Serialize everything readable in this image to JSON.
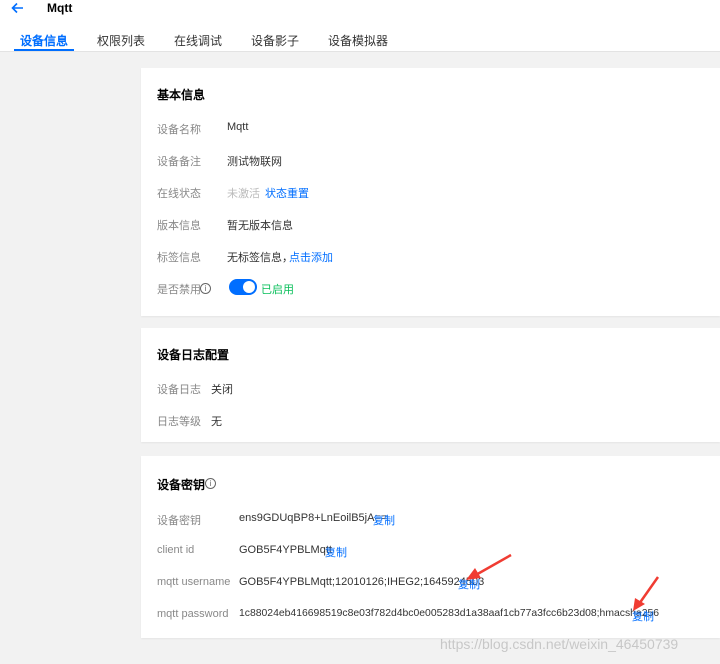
{
  "header": {
    "title": "Mqtt",
    "tabs": [
      "设备信息",
      "权限列表",
      "在线调试",
      "设备影子",
      "设备模拟器"
    ]
  },
  "basic": {
    "title": "基本信息",
    "name_label": "设备名称",
    "name_value": "Mqtt",
    "remark_label": "设备备注",
    "remark_value": "测试物联网",
    "online_label": "在线状态",
    "online_value": "未激活",
    "online_link": "状态重置",
    "version_label": "版本信息",
    "version_value": "暂无版本信息",
    "tag_label": "标签信息",
    "tag_value": "无标签信息，",
    "tag_link": "点击添加",
    "disable_label": "是否禁用",
    "disable_status": "已启用"
  },
  "log": {
    "title": "设备日志配置",
    "log_label": "设备日志",
    "log_value": "关闭",
    "level_label": "日志等级",
    "level_value": "无"
  },
  "secret": {
    "title": "设备密钥",
    "key_label": "设备密钥",
    "key_value": "ens9GDUqBP8+LnEoilB5jA==",
    "client_label": "client id",
    "client_value": "GOB5F4YPBLMqtt",
    "user_label": "mqtt username",
    "user_value": "GOB5F4YPBLMqtt;12010126;IHEG2;1645924503",
    "pass_label": "mqtt password",
    "pass_value": "1c88024eb416698519c8e03f782d4bc0e005283d1a38aaf1cb77a3fcc6b23d08;hmacsha256",
    "copy": "复制"
  },
  "watermark": "https://blog.csdn.net/weixin_46450739",
  "colors": {
    "accent": "#006eff",
    "success": "#0abf5b",
    "annotation": "#f03c32"
  }
}
